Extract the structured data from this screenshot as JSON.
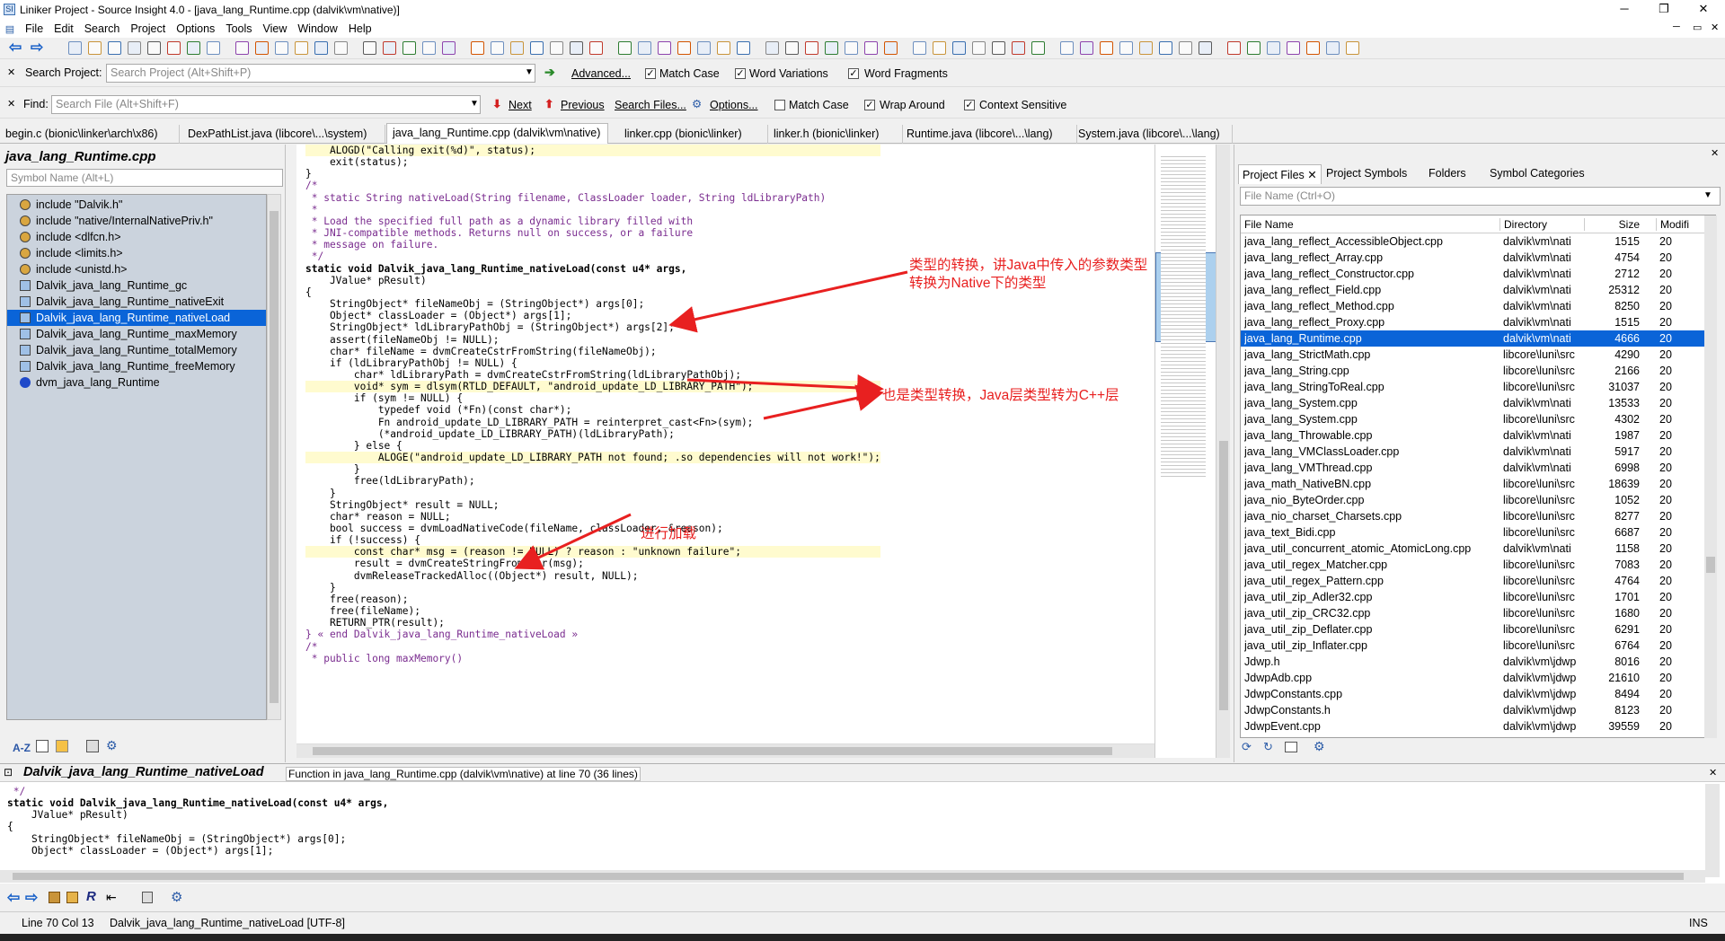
{
  "window": {
    "title": "Liniker Project - Source Insight 4.0 - [java_lang_Runtime.cpp (dalvik\\vm\\native)]",
    "app_icon": "SI",
    "controls": [
      "─",
      "❐",
      "✕"
    ],
    "sub_controls": [
      "─",
      "▭",
      "✕"
    ]
  },
  "menu": [
    "File",
    "Edit",
    "Search",
    "Project",
    "Options",
    "Tools",
    "View",
    "Window",
    "Help"
  ],
  "search_project": {
    "close": "✕",
    "label": "Search Project:",
    "placeholder": "Search Project (Alt+Shift+P)",
    "go": "➔",
    "advanced": "Advanced...",
    "options": [
      {
        "label": "Match Case",
        "checked": "✓"
      },
      {
        "label": "Word Variations",
        "checked": "✓"
      },
      {
        "label": "Word Fragments",
        "checked": "✓"
      }
    ]
  },
  "find": {
    "close": "✕",
    "label": "Find:",
    "placeholder": "Search File (Alt+Shift+F)",
    "next": "Next",
    "previous": "Previous",
    "search_files": "Search Files...",
    "options_btn": "Options...",
    "options": [
      {
        "label": "Match Case",
        "checked": ""
      },
      {
        "label": "Wrap Around",
        "checked": "✓"
      },
      {
        "label": "Context Sensitive",
        "checked": "✓"
      }
    ]
  },
  "tabs": [
    "begin.c (bionic\\linker\\arch\\x86)",
    "DexPathList.java (libcore\\...\\system)",
    "java_lang_Runtime.cpp (dalvik\\vm\\native)",
    "linker.cpp (bionic\\linker)",
    "linker.h (bionic\\linker)",
    "Runtime.java (libcore\\...\\lang)",
    "System.java (libcore\\...\\lang)"
  ],
  "left_panel": {
    "title": "java_lang_Runtime.cpp",
    "symbol_placeholder": "Symbol Name (Alt+L)",
    "items": [
      {
        "label": "include \"Dalvik.h\"",
        "icon": "include-icon"
      },
      {
        "label": "include \"native/InternalNativePriv.h\"",
        "icon": "include-icon"
      },
      {
        "label": "include <dlfcn.h>",
        "icon": "include-icon"
      },
      {
        "label": "include <limits.h>",
        "icon": "include-icon"
      },
      {
        "label": "include <unistd.h>",
        "icon": "include-icon"
      },
      {
        "label": "Dalvik_java_lang_Runtime_gc",
        "icon": "function-icon"
      },
      {
        "label": "Dalvik_java_lang_Runtime_nativeExit",
        "icon": "function-icon"
      },
      {
        "label": "Dalvik_java_lang_Runtime_nativeLoad",
        "icon": "function-icon",
        "selected": true
      },
      {
        "label": "Dalvik_java_lang_Runtime_maxMemory",
        "icon": "function-icon"
      },
      {
        "label": "Dalvik_java_lang_Runtime_totalMemory",
        "icon": "function-icon"
      },
      {
        "label": "Dalvik_java_lang_Runtime_freeMemory",
        "icon": "function-icon"
      },
      {
        "label": "dvm_java_lang_Runtime",
        "icon": "variable-icon"
      }
    ],
    "footer_az": "A-Z"
  },
  "code_lines": [
    "    ALOGD(\"Calling exit(%d)\", status);",
    "    exit(status);",
    "}",
    "",
    "/*",
    " * static String nativeLoad(String filename, ClassLoader loader, String ldLibraryPath)",
    " *",
    " * Load the specified full path as a dynamic library filled with",
    " * JNI-compatible methods. Returns null on success, or a failure",
    " * message on failure.",
    " */",
    "static void Dalvik_java_lang_Runtime_nativeLoad(const u4* args,",
    "    JValue* pResult)",
    "{",
    "    StringObject* fileNameObj = (StringObject*) args[0];",
    "    Object* classLoader = (Object*) args[1];",
    "    StringObject* ldLibraryPathObj = (StringObject*) args[2];",
    "",
    "    assert(fileNameObj != NULL);",
    "    char* fileName = dvmCreateCstrFromString(fileNameObj);",
    "",
    "    if (ldLibraryPathObj != NULL) {",
    "        char* ldLibraryPath = dvmCreateCstrFromString(ldLibraryPathObj);",
    "        void* sym = dlsym(RTLD_DEFAULT, \"android_update_LD_LIBRARY_PATH\");",
    "        if (sym != NULL) {",
    "            typedef void (*Fn)(const char*);",
    "            Fn android_update_LD_LIBRARY_PATH = reinterpret_cast<Fn>(sym);",
    "            (*android_update_LD_LIBRARY_PATH)(ldLibraryPath);",
    "        } else {",
    "            ALOGE(\"android_update_LD_LIBRARY_PATH not found; .so dependencies will not work!\");",
    "        }",
    "        free(ldLibraryPath);",
    "    }",
    "",
    "    StringObject* result = NULL;",
    "    char* reason = NULL;",
    "    bool success = dvmLoadNativeCode(fileName, classLoader, &reason);",
    "    if (!success) {",
    "        const char* msg = (reason != NULL) ? reason : \"unknown failure\";",
    "        result = dvmCreateStringFromCstr(msg);",
    "        dvmReleaseTrackedAlloc((Object*) result, NULL);",
    "    }",
    "",
    "    free(reason);",
    "    free(fileName);",
    "    RETURN_PTR(result);",
    "} « end Dalvik_java_lang_Runtime_nativeLoad »",
    "",
    "/*",
    " * public long maxMemory()"
  ],
  "annotations": {
    "a1": "类型的转换，讲Java中传入的参数类型",
    "a1b": "转换为Native下的类型",
    "a2": "也是类型转换，Java层类型转为C++层",
    "a3": "进行加载",
    "color": "#e82020"
  },
  "right_panel": {
    "tabs": [
      "Project Files",
      "Project Symbols",
      "Folders",
      "Symbol Categories"
    ],
    "close": "✕",
    "file_placeholder": "File Name (Ctrl+O)",
    "columns": [
      "File Name",
      "Directory",
      "Size",
      "Modifi"
    ],
    "files": [
      [
        "java_lang_reflect_AccessibleObject.cpp",
        "dalvik\\vm\\nati",
        "1515",
        "20"
      ],
      [
        "java_lang_reflect_Array.cpp",
        "dalvik\\vm\\nati",
        "4754",
        "20"
      ],
      [
        "java_lang_reflect_Constructor.cpp",
        "dalvik\\vm\\nati",
        "2712",
        "20"
      ],
      [
        "java_lang_reflect_Field.cpp",
        "dalvik\\vm\\nati",
        "25312",
        "20"
      ],
      [
        "java_lang_reflect_Method.cpp",
        "dalvik\\vm\\nati",
        "8250",
        "20"
      ],
      [
        "java_lang_reflect_Proxy.cpp",
        "dalvik\\vm\\nati",
        "1515",
        "20"
      ],
      [
        "java_lang_Runtime.cpp",
        "dalvik\\vm\\nati",
        "4666",
        "20"
      ],
      [
        "java_lang_StrictMath.cpp",
        "libcore\\luni\\src",
        "4290",
        "20"
      ],
      [
        "java_lang_String.cpp",
        "libcore\\luni\\src",
        "2166",
        "20"
      ],
      [
        "java_lang_StringToReal.cpp",
        "libcore\\luni\\src",
        "31037",
        "20"
      ],
      [
        "java_lang_System.cpp",
        "dalvik\\vm\\nati",
        "13533",
        "20"
      ],
      [
        "java_lang_System.cpp",
        "libcore\\luni\\src",
        "4302",
        "20"
      ],
      [
        "java_lang_Throwable.cpp",
        "dalvik\\vm\\nati",
        "1987",
        "20"
      ],
      [
        "java_lang_VMClassLoader.cpp",
        "dalvik\\vm\\nati",
        "5917",
        "20"
      ],
      [
        "java_lang_VMThread.cpp",
        "dalvik\\vm\\nati",
        "6998",
        "20"
      ],
      [
        "java_math_NativeBN.cpp",
        "libcore\\luni\\src",
        "18639",
        "20"
      ],
      [
        "java_nio_ByteOrder.cpp",
        "libcore\\luni\\src",
        "1052",
        "20"
      ],
      [
        "java_nio_charset_Charsets.cpp",
        "libcore\\luni\\src",
        "8277",
        "20"
      ],
      [
        "java_text_Bidi.cpp",
        "libcore\\luni\\src",
        "6687",
        "20"
      ],
      [
        "java_util_concurrent_atomic_AtomicLong.cpp",
        "dalvik\\vm\\nati",
        "1158",
        "20"
      ],
      [
        "java_util_regex_Matcher.cpp",
        "libcore\\luni\\src",
        "7083",
        "20"
      ],
      [
        "java_util_regex_Pattern.cpp",
        "libcore\\luni\\src",
        "4764",
        "20"
      ],
      [
        "java_util_zip_Adler32.cpp",
        "libcore\\luni\\src",
        "1701",
        "20"
      ],
      [
        "java_util_zip_CRC32.cpp",
        "libcore\\luni\\src",
        "1680",
        "20"
      ],
      [
        "java_util_zip_Deflater.cpp",
        "libcore\\luni\\src",
        "6291",
        "20"
      ],
      [
        "java_util_zip_Inflater.cpp",
        "libcore\\luni\\src",
        "6764",
        "20"
      ],
      [
        "Jdwp.h",
        "dalvik\\vm\\jdwp",
        "8016",
        "20"
      ],
      [
        "JdwpAdb.cpp",
        "dalvik\\vm\\jdwp",
        "21610",
        "20"
      ],
      [
        "JdwpConstants.cpp",
        "dalvik\\vm\\jdwp",
        "8494",
        "20"
      ],
      [
        "JdwpConstants.h",
        "dalvik\\vm\\jdwp",
        "8123",
        "20"
      ],
      [
        "JdwpEvent.cpp",
        "dalvik\\vm\\jdwp",
        "39559",
        "20"
      ]
    ],
    "selected_index": 6
  },
  "bottom_panel": {
    "symbol": "Dalvik_java_lang_Runtime_nativeLoad",
    "info": "Function in java_lang_Runtime.cpp (dalvik\\vm\\native) at line 70 (36 lines)",
    "lines": [
      " */",
      "static void Dalvik_java_lang_Runtime_nativeLoad(const u4* args,",
      "    JValue* pResult)",
      "{",
      "    StringObject* fileNameObj = (StringObject*) args[0];",
      "    Object* classLoader = (Object*) args[1];"
    ]
  },
  "status": {
    "position": "Line 70  Col 13",
    "symbol": "Dalvik_java_lang_Runtime_nativeLoad [UTF-8]",
    "mode": "INS"
  }
}
